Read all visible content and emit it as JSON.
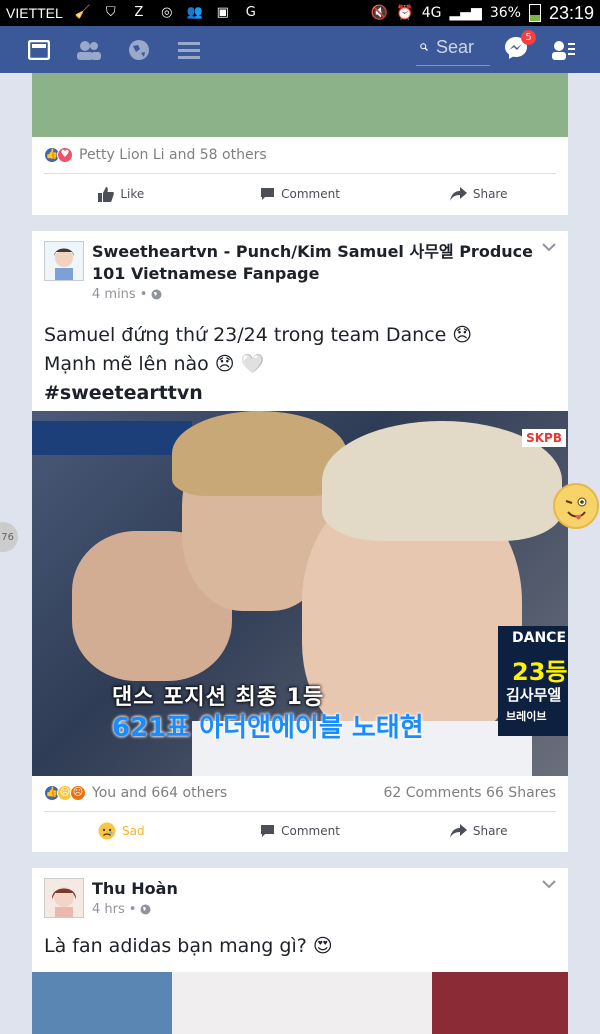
{
  "status_bar": {
    "carrier": "VIETTEL",
    "network": "4G",
    "battery": "36%",
    "battery_level": 0.36,
    "time": "23:19"
  },
  "nav": {
    "search_placeholder": "Sear",
    "messages_badge": "5"
  },
  "post1": {
    "reactions_text": "Petty Lion Li and 58 others",
    "like_label": "Like",
    "comment_label": "Comment",
    "share_label": "Share"
  },
  "post2": {
    "page_name": "Sweetheartvn - Punch/Kim Samuel 사무엘 Produce 101 Vietnamese Fanpage",
    "time": "4 mins",
    "line1": "Samuel đứng thứ 23/24 trong team Dance 😞",
    "line2": "Mạnh mẽ lên nào 😞 🤍",
    "hashtag": "#sweetearttvn",
    "photo": {
      "channel_logo": "SKPB",
      "caption_top": "댄스 포지션 최종 1등",
      "caption_bottom": "621표 아더앤에이블 노태현",
      "rank_label": "DANCE",
      "rank_number": "23등",
      "rank_name": "김사무엘",
      "rank_sub": "브레이브"
    },
    "reactions_text": "You and 664 others",
    "comments_shares": "62 Comments 66 Shares",
    "sad_label": "Sad",
    "comment_label": "Comment",
    "share_label": "Share"
  },
  "post3": {
    "author": "Thu Hoàn",
    "time": "4 hrs",
    "text": "Là fan adidas bạn mang gì? 😍"
  },
  "side_counter": "76"
}
